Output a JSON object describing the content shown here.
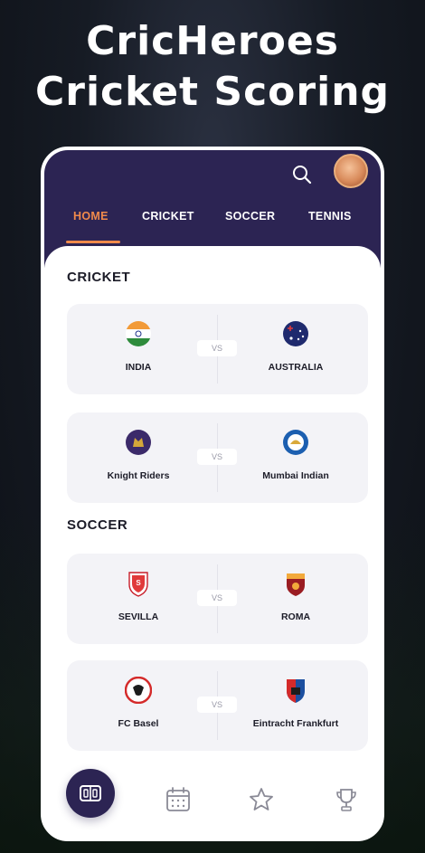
{
  "headline": {
    "line1": "CricHeroes",
    "line2": "Cricket Scoring"
  },
  "header": {
    "tabs": [
      {
        "label": "HOME",
        "active": true
      },
      {
        "label": "CRICKET",
        "active": false
      },
      {
        "label": "SOCCER",
        "active": false
      },
      {
        "label": "TENNIS",
        "active": false
      }
    ]
  },
  "sections": [
    {
      "title": "CRICKET",
      "matches": [
        {
          "home": "INDIA",
          "away": "AUSTRALIA",
          "vs": "VS"
        },
        {
          "home": "Knight Riders",
          "away": "Mumbai Indian",
          "vs": "VS"
        }
      ]
    },
    {
      "title": "SOCCER",
      "matches": [
        {
          "home": "SEVILLA",
          "away": "ROMA",
          "vs": "VS"
        },
        {
          "home": "FC Basel",
          "away": "Eintracht Frankfurt",
          "vs": "VS"
        }
      ]
    }
  ],
  "bottom_nav": [
    {
      "icon": "scoreboard-icon",
      "active": true
    },
    {
      "icon": "calendar-icon",
      "active": false
    },
    {
      "icon": "star-icon",
      "active": false
    },
    {
      "icon": "trophy-icon",
      "active": false
    }
  ],
  "colors": {
    "header_bg": "#2c2453",
    "accent": "#f08a4b",
    "card_bg": "#f3f3f7"
  }
}
